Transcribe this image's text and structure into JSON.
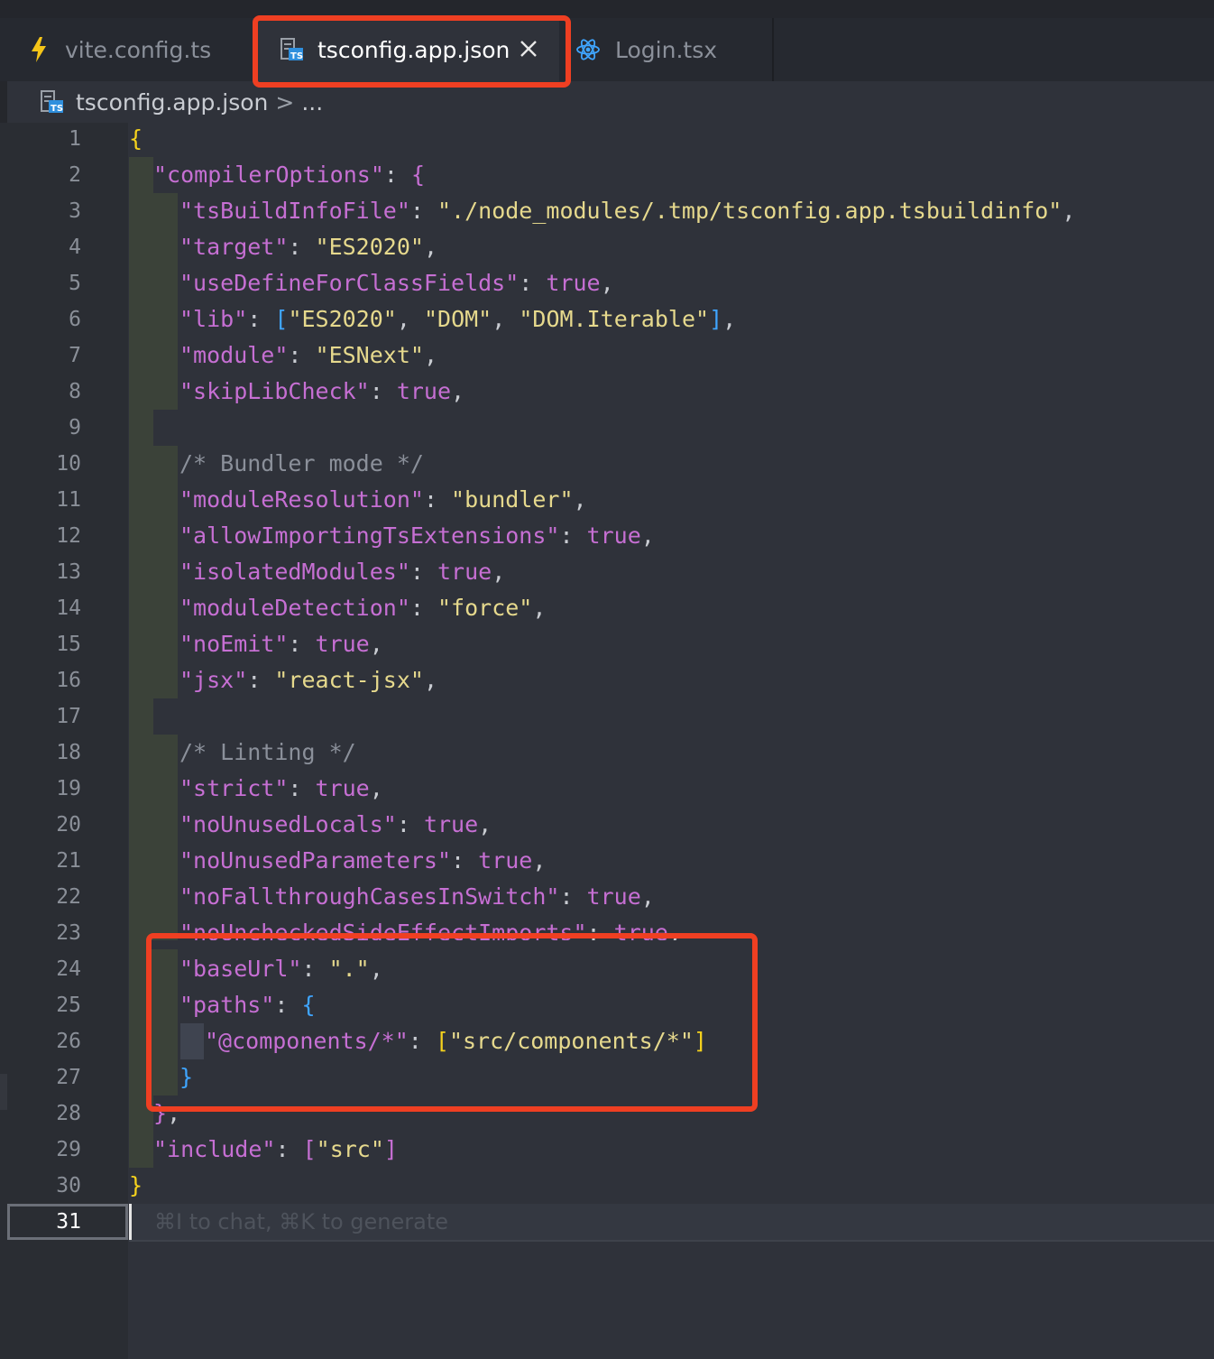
{
  "tabs": [
    {
      "label": "vite.config.ts",
      "icon": "lightning-icon",
      "active": false
    },
    {
      "label": "tsconfig.app.json",
      "icon": "ts-config-file-icon",
      "active": true
    },
    {
      "label": "Login.tsx",
      "icon": "react-icon",
      "active": false
    }
  ],
  "breadcrumb": {
    "file": "tsconfig.app.json",
    "separator": ">",
    "more": "..."
  },
  "editor": {
    "current_line": 31,
    "placeholder": "⌘I to chat, ⌘K to generate",
    "line_numbers": [
      "1",
      "2",
      "3",
      "4",
      "5",
      "6",
      "7",
      "8",
      "9",
      "10",
      "11",
      "12",
      "13",
      "14",
      "15",
      "16",
      "17",
      "18",
      "19",
      "20",
      "21",
      "22",
      "23",
      "24",
      "25",
      "26",
      "27",
      "28",
      "29",
      "30",
      "31"
    ],
    "lines": [
      "{",
      "\"compilerOptions\": {",
      "\"tsBuildInfoFile\": \"./node_modules/.tmp/tsconfig.app.tsbuildinfo\",",
      "\"target\": \"ES2020\",",
      "\"useDefineForClassFields\": true,",
      "\"lib\": [\"ES2020\", \"DOM\", \"DOM.Iterable\"],",
      "\"module\": \"ESNext\",",
      "\"skipLibCheck\": true,",
      "",
      "/* Bundler mode */",
      "\"moduleResolution\": \"bundler\",",
      "\"allowImportingTsExtensions\": true,",
      "\"isolatedModules\": true,",
      "\"moduleDetection\": \"force\",",
      "\"noEmit\": true,",
      "\"jsx\": \"react-jsx\",",
      "",
      "/* Linting */",
      "\"strict\": true,",
      "\"noUnusedLocals\": true,",
      "\"noUnusedParameters\": true,",
      "\"noFallthroughCasesInSwitch\": true,",
      "\"noUncheckedSideEffectImports\": true,",
      "\"baseUrl\": \".\",",
      "\"paths\": {",
      "\"@components/*\": [\"src/components/*\"]",
      "}",
      "},",
      "\"include\": [\"src\"]",
      "}",
      ""
    ]
  },
  "colors": {
    "highlight": "#ef3f22",
    "key": "#c66fd3",
    "string": "#e6d98d",
    "brace": "#f5d21d",
    "bracket_blue": "#3fa5ff"
  }
}
